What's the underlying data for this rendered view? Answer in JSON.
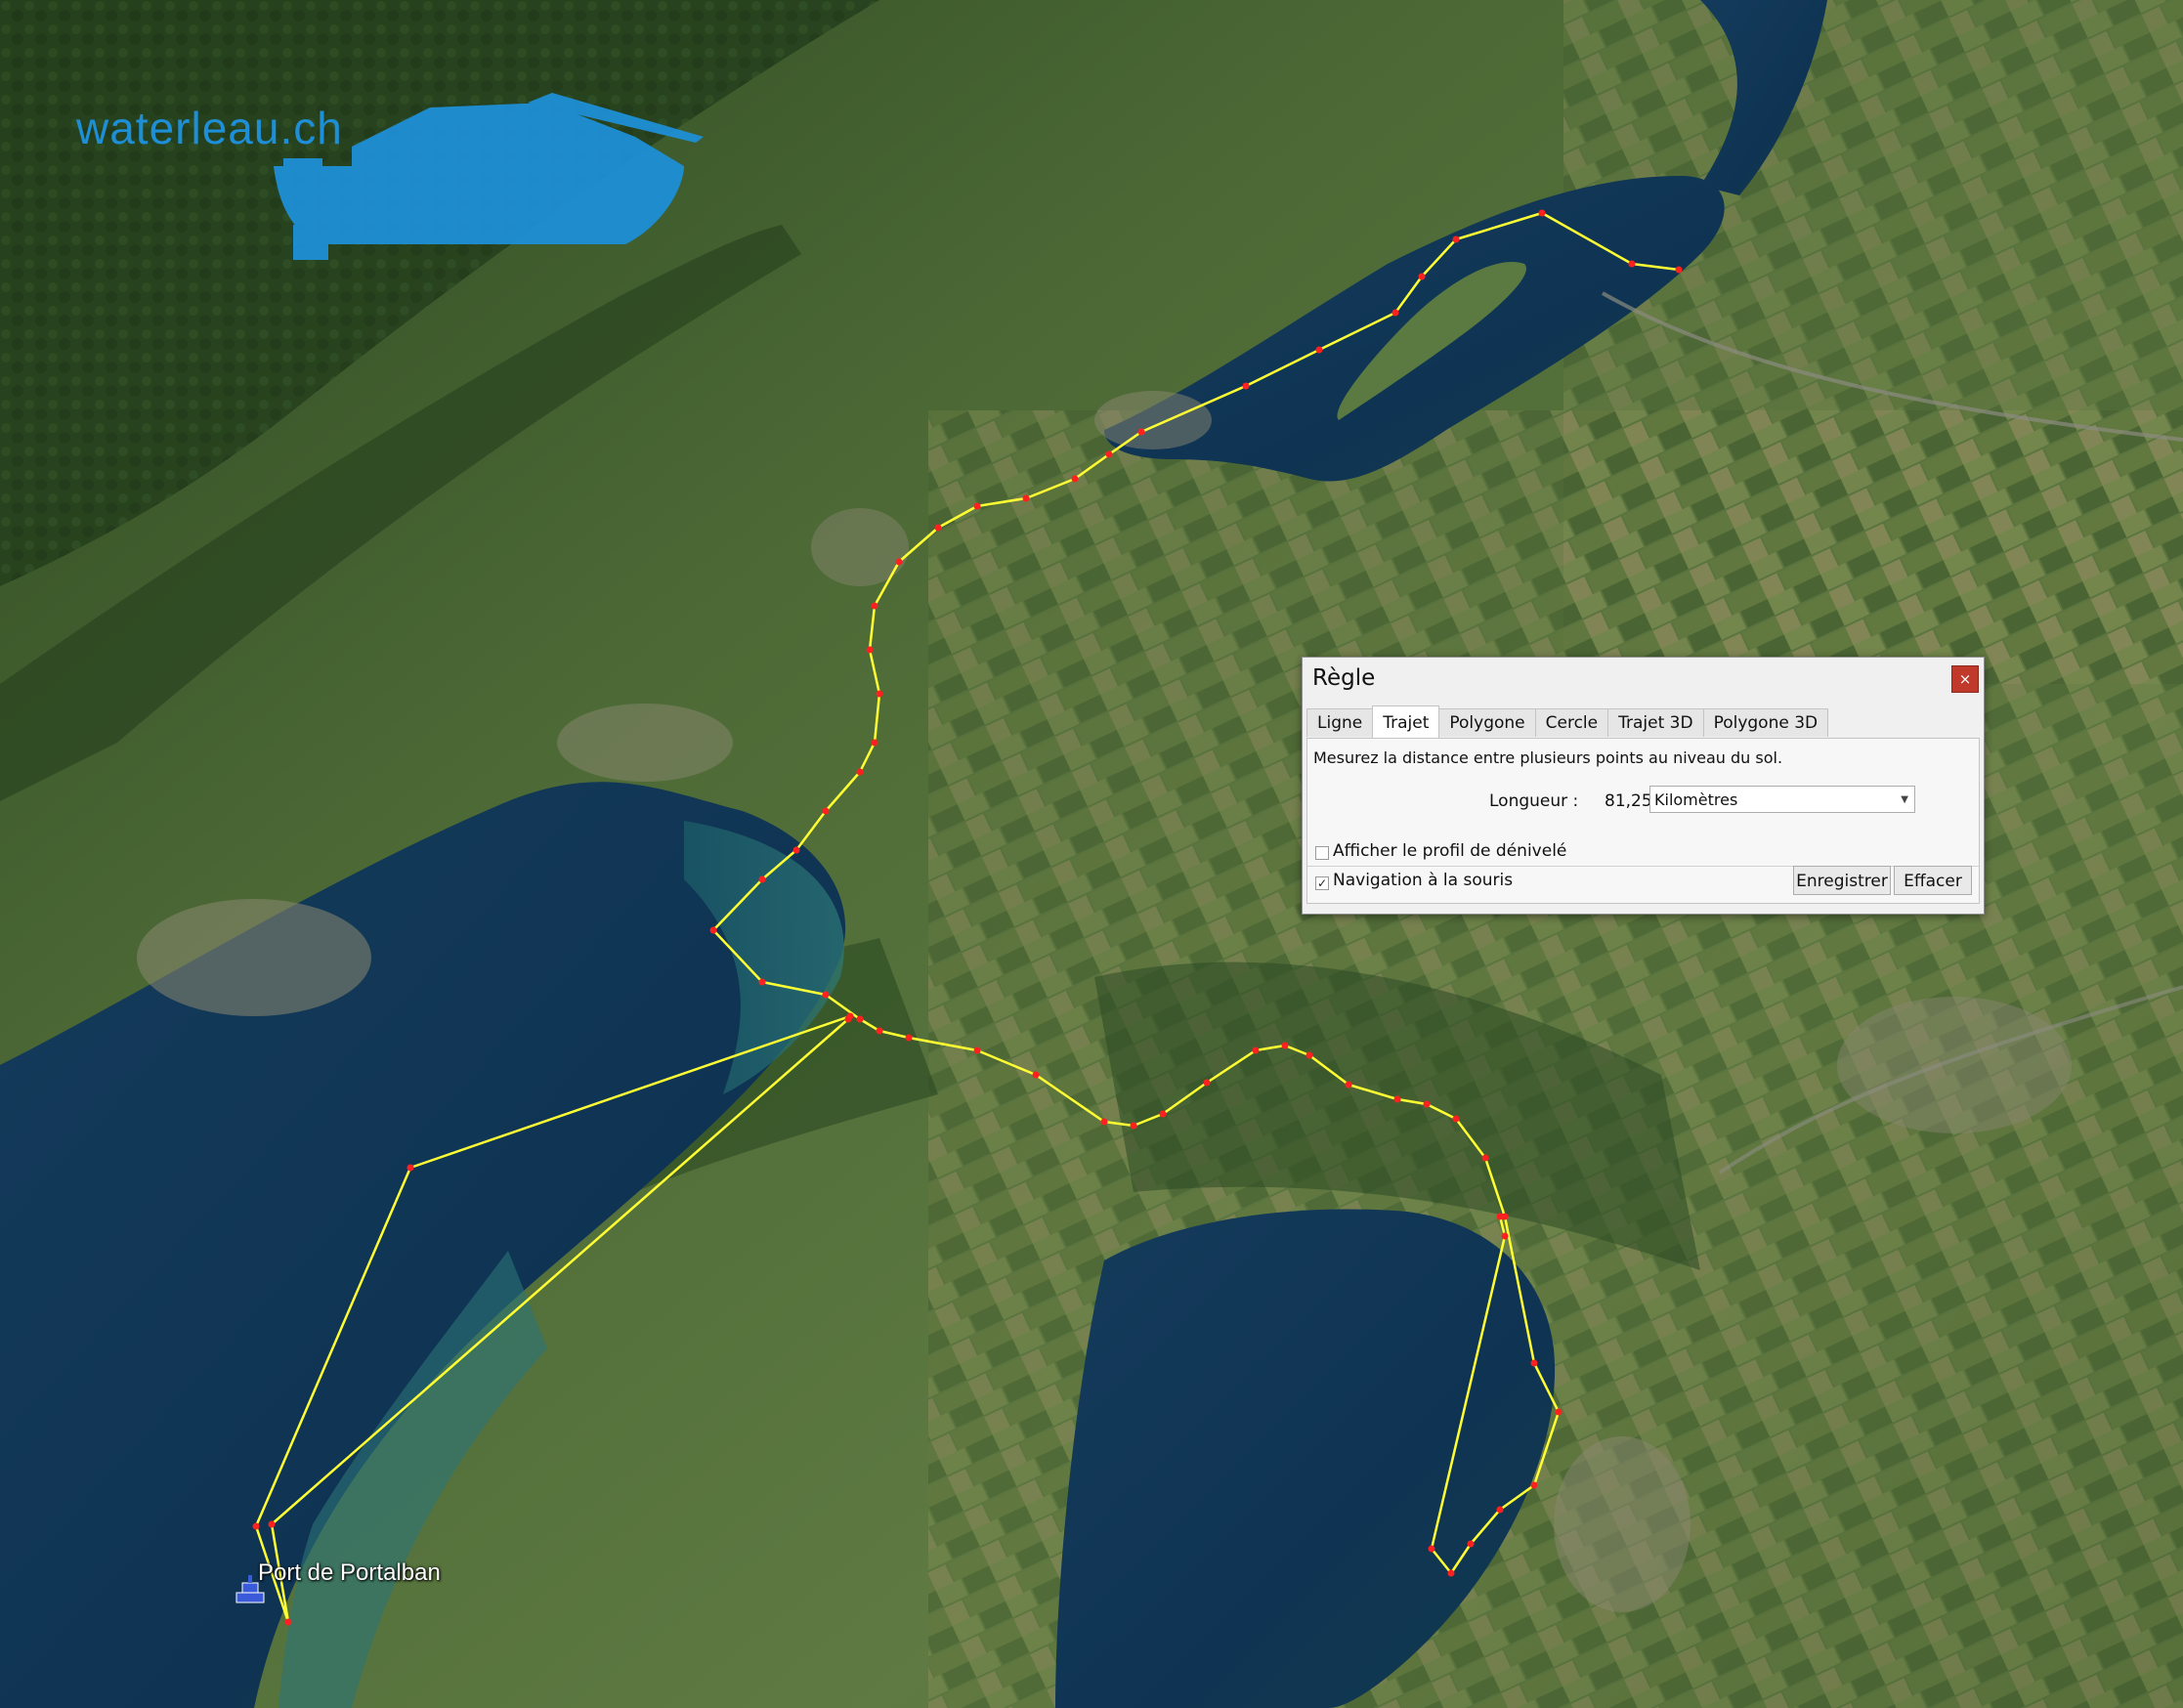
{
  "brand": {
    "text": "waterleau.ch",
    "color": "#1e8fd6"
  },
  "map": {
    "place_label": "Port de Portalban",
    "place_icon": "boat-harbor-icon",
    "route_color": "#ffff33",
    "vertex_color": "#ff2020"
  },
  "ruler": {
    "title": "Règle",
    "close_label": "×",
    "tabs": [
      {
        "label": "Ligne",
        "active": false
      },
      {
        "label": "Trajet",
        "active": true
      },
      {
        "label": "Polygone",
        "active": false
      },
      {
        "label": "Cercle",
        "active": false
      },
      {
        "label": "Trajet 3D",
        "active": false
      },
      {
        "label": "Polygone 3D",
        "active": false
      }
    ],
    "description": "Mesurez la distance entre plusieurs points au niveau du sol.",
    "length_label": "Longueur :",
    "length_value": "81,25",
    "unit": "Kilomètres",
    "elevation_profile_label": "Afficher le profil de dénivelé",
    "elevation_profile_checked": false,
    "mouse_nav_label": "Navigation à la souris",
    "mouse_nav_checked": true,
    "save_label": "Enregistrer",
    "clear_label": "Effacer"
  }
}
